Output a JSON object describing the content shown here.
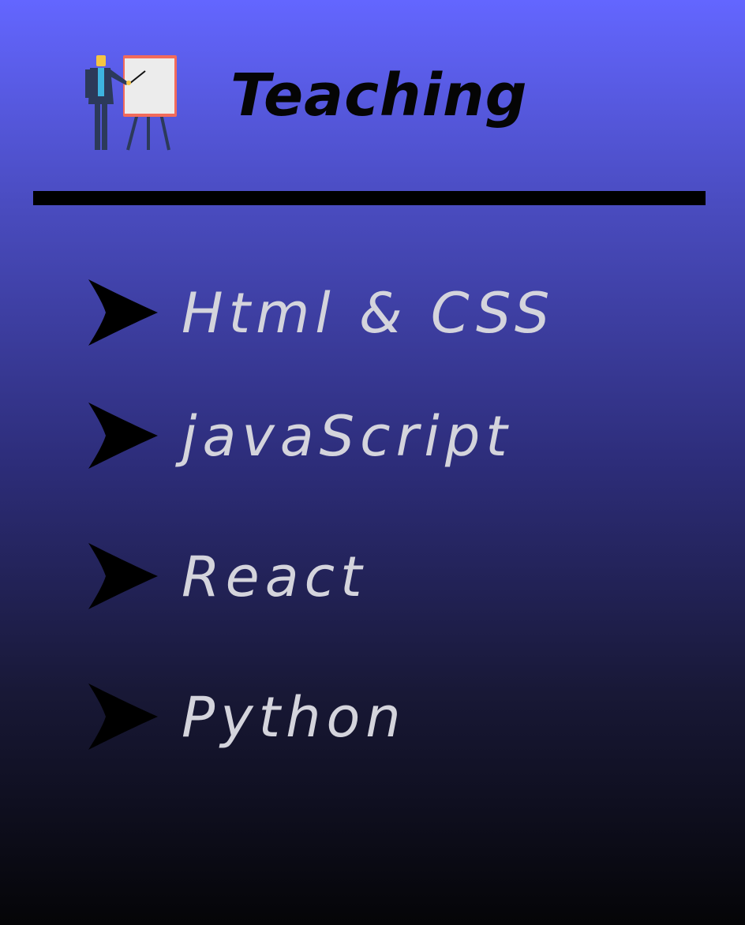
{
  "header": {
    "title": "Teaching",
    "icon": "teacher-presentation-icon"
  },
  "list": {
    "bullet_icon": "arrow-bullet-icon",
    "items": [
      {
        "label": "Html & CSS"
      },
      {
        "label": "javaScript"
      },
      {
        "label": "React"
      },
      {
        "label": "Python"
      }
    ]
  },
  "colors": {
    "background_top": "#6366ff",
    "background_bottom": "#050507",
    "title_text": "#050505",
    "item_text": "#d4d4dc",
    "divider": "#000000",
    "board_frame": "#f26b5b",
    "board_surface": "#ececec",
    "suit": "#2c3a5a",
    "shirt": "#3db4e0",
    "hair": "#f5c542"
  }
}
